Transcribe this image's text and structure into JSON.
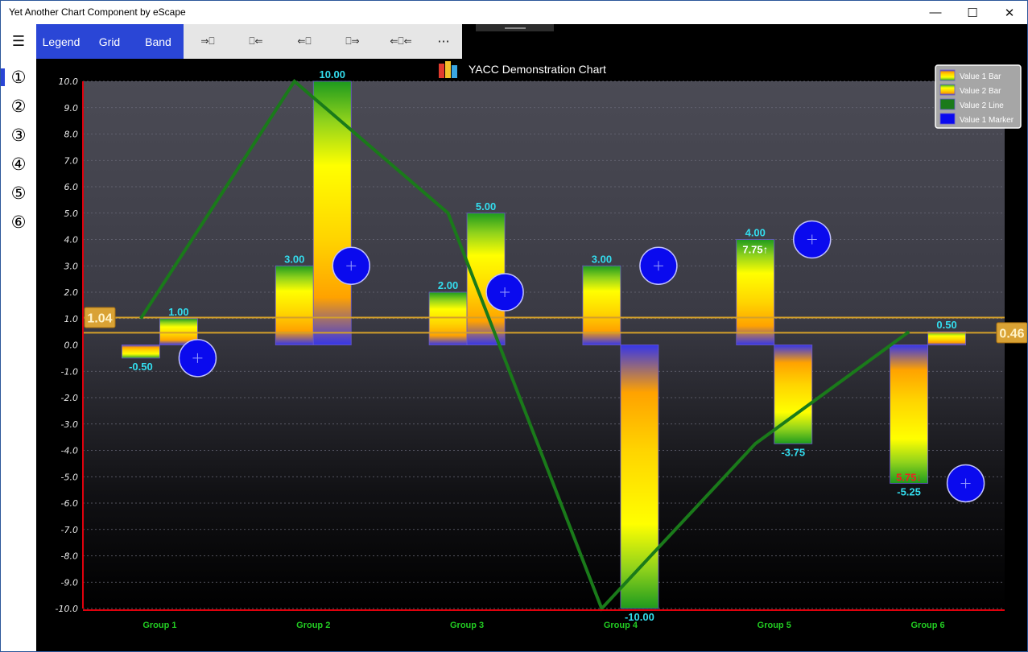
{
  "window": {
    "title": "Yet Another Chart Component by eScape",
    "minimize_glyph": "—",
    "maximize_glyph": "☐",
    "close_glyph": "✕"
  },
  "sidebar": {
    "menu_glyph": "☰",
    "items": [
      {
        "label": "①",
        "selected": true
      },
      {
        "label": "②",
        "selected": false
      },
      {
        "label": "③",
        "selected": false
      },
      {
        "label": "④",
        "selected": false
      },
      {
        "label": "⑤",
        "selected": false
      },
      {
        "label": "⑥",
        "selected": false
      }
    ]
  },
  "toolbar": {
    "tabs": [
      "Legend",
      "Grid",
      "Band"
    ],
    "commands": [
      "⇒⎕",
      "⎕⇐",
      "⇐⎕",
      "⎕⇒",
      "⇐⎕⇐",
      "···"
    ]
  },
  "colors": {
    "accent": "#2a46d6",
    "axis": "#e0000c",
    "group_label": "#22cc22",
    "value_label": "#33ddee",
    "line": "#1a7a1a",
    "marker": "#0a0aee",
    "band": "#d4a02a"
  },
  "chart_data": {
    "type": "bar",
    "title": "YACC Demonstration Chart",
    "ylim": [
      -10,
      10
    ],
    "y_ticks": [
      "10.0",
      "9.0",
      "8.0",
      "7.0",
      "6.0",
      "5.0",
      "4.0",
      "3.0",
      "2.0",
      "1.0",
      "0.0",
      "-1.0",
      "-2.0",
      "-3.0",
      "-4.0",
      "-5.0",
      "-6.0",
      "-7.0",
      "-8.0",
      "-9.0",
      "-10.0"
    ],
    "grid": true,
    "categories": [
      "Group 1",
      "Group 2",
      "Group 3",
      "Group 4",
      "Group 5",
      "Group 6"
    ],
    "series": [
      {
        "name": "Value 1 Bar",
        "values": [
          -0.5,
          3.0,
          2.0,
          3.0,
          4.0,
          -5.25
        ],
        "labels": [
          "-0.50",
          "3.00",
          "2.00",
          "3.00",
          "4.00",
          "-5.25"
        ]
      },
      {
        "name": "Value 2 Bar",
        "values": [
          1.0,
          10.0,
          5.0,
          -10.0,
          -3.75,
          0.5
        ],
        "labels": [
          "1.00",
          "10.00",
          "5.00",
          "-10.00",
          "-3.75",
          "0.50"
        ]
      },
      {
        "name": "Value 2 Line",
        "values": [
          1.0,
          10.0,
          5.0,
          -10.0,
          -3.75,
          0.5
        ]
      },
      {
        "name": "Value 1 Marker",
        "values": [
          -0.5,
          3.0,
          2.0,
          3.0,
          4.0,
          -5.25
        ]
      }
    ],
    "band": {
      "upper": 1.04,
      "lower": 0.46,
      "upper_label": "1.04",
      "lower_label": "0.46"
    },
    "annotations": [
      {
        "category": "Group 5",
        "text": "7.75↑",
        "color": "#ffffff"
      },
      {
        "category": "Group 6",
        "text": "5.75↓",
        "color": "#ee2222"
      }
    ],
    "legend": {
      "position": "top-right",
      "entries": [
        "Value 1 Bar",
        "Value 2 Bar",
        "Value 2 Line",
        "Value 1 Marker"
      ]
    }
  }
}
